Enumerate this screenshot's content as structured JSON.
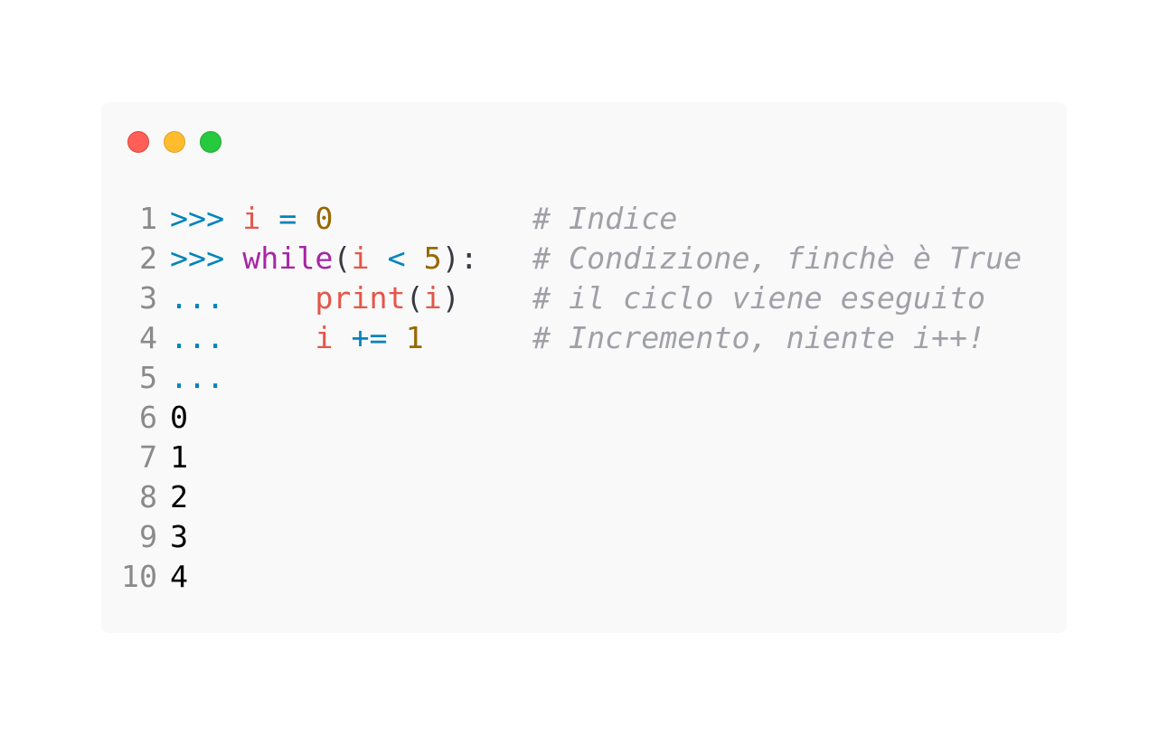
{
  "window": {
    "traffic_lights": [
      {
        "name": "close",
        "color": "#ff5f56",
        "border": "#e0443e"
      },
      {
        "name": "minimize",
        "color": "#ffbd2e",
        "border": "#dea123"
      },
      {
        "name": "maximize",
        "color": "#27c93f",
        "border": "#1aab29"
      }
    ]
  },
  "colors": {
    "prompt": "#0184bc",
    "variable": "#e45649",
    "keyword": "#a626a4",
    "number": "#986801",
    "punctuation": "#383a42",
    "comment": "#a0a1a7",
    "output": "#000000",
    "line_number": "#8a8a8a",
    "function": "#e45649"
  },
  "code_lines": [
    {
      "number": "1",
      "tokens": [
        {
          "text": ">>> ",
          "type": "prompt"
        },
        {
          "text": "i",
          "type": "variable"
        },
        {
          "text": " ",
          "type": "punctuation"
        },
        {
          "text": "=",
          "type": "prompt"
        },
        {
          "text": " ",
          "type": "punctuation"
        },
        {
          "text": "0",
          "type": "number"
        },
        {
          "text": "           ",
          "type": "punctuation"
        },
        {
          "text": "# Indice",
          "type": "comment"
        }
      ]
    },
    {
      "number": "2",
      "tokens": [
        {
          "text": ">>> ",
          "type": "prompt"
        },
        {
          "text": "while",
          "type": "keyword"
        },
        {
          "text": "(",
          "type": "punctuation"
        },
        {
          "text": "i",
          "type": "variable"
        },
        {
          "text": " ",
          "type": "punctuation"
        },
        {
          "text": "<",
          "type": "prompt"
        },
        {
          "text": " ",
          "type": "punctuation"
        },
        {
          "text": "5",
          "type": "number"
        },
        {
          "text": "):",
          "type": "punctuation"
        },
        {
          "text": "   ",
          "type": "punctuation"
        },
        {
          "text": "# Condizione, finchè è True",
          "type": "comment"
        }
      ]
    },
    {
      "number": "3",
      "tokens": [
        {
          "text": "...     ",
          "type": "prompt"
        },
        {
          "text": "print",
          "type": "function"
        },
        {
          "text": "(",
          "type": "punctuation"
        },
        {
          "text": "i",
          "type": "variable"
        },
        {
          "text": ")",
          "type": "punctuation"
        },
        {
          "text": "    ",
          "type": "punctuation"
        },
        {
          "text": "# il ciclo viene eseguito",
          "type": "comment"
        }
      ]
    },
    {
      "number": "4",
      "tokens": [
        {
          "text": "...     ",
          "type": "prompt"
        },
        {
          "text": "i",
          "type": "variable"
        },
        {
          "text": " ",
          "type": "punctuation"
        },
        {
          "text": "+=",
          "type": "prompt"
        },
        {
          "text": " ",
          "type": "punctuation"
        },
        {
          "text": "1",
          "type": "number"
        },
        {
          "text": "      ",
          "type": "punctuation"
        },
        {
          "text": "# Incremento, niente i++!",
          "type": "comment"
        }
      ]
    },
    {
      "number": "5",
      "tokens": [
        {
          "text": "...",
          "type": "prompt"
        }
      ]
    },
    {
      "number": "6",
      "tokens": [
        {
          "text": "0",
          "type": "output"
        }
      ]
    },
    {
      "number": "7",
      "tokens": [
        {
          "text": "1",
          "type": "output"
        }
      ]
    },
    {
      "number": "8",
      "tokens": [
        {
          "text": "2",
          "type": "output"
        }
      ]
    },
    {
      "number": "9",
      "tokens": [
        {
          "text": "3",
          "type": "output"
        }
      ]
    },
    {
      "number": "10",
      "tokens": [
        {
          "text": "4",
          "type": "output"
        }
      ]
    }
  ]
}
